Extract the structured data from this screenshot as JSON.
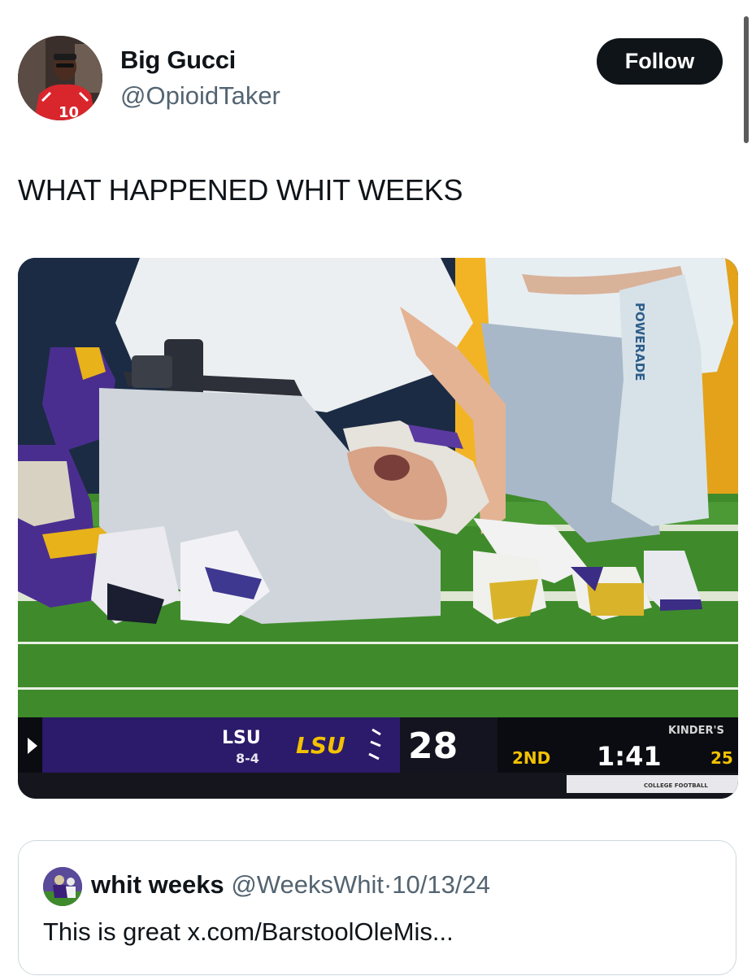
{
  "author": {
    "display_name": "Big Gucci",
    "handle": "@OpioidTaker"
  },
  "follow_label": "Follow",
  "tweet": {
    "text": "WHAT HAPPENED WHIT WEEKS"
  },
  "media": {
    "scorebug": {
      "team_abbr": "LSU",
      "record": "8-4",
      "team_logo_text": "LSU",
      "score": "28",
      "quarter": "2ND",
      "clock": "1:41",
      "sponsor": "KINDER'S",
      "other_value": "25",
      "bottom_caption": "COLLEGE FOOTBALL"
    },
    "towel_text": "POWERADE"
  },
  "quote": {
    "name": "whit weeks",
    "handle": "@WeeksWhit",
    "separator": "·",
    "date": "10/13/24",
    "text": "This is great x.com/BarstoolOleMis..."
  },
  "colors": {
    "lsu_purple": "#3b1f7a",
    "lsu_gold": "#f2c200",
    "field_green": "#3e8a2a"
  }
}
